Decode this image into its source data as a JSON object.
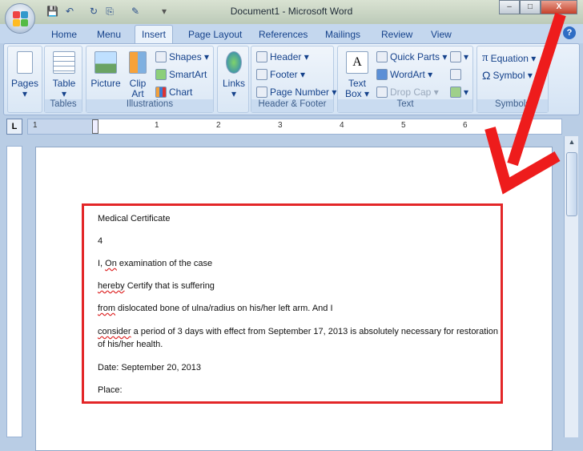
{
  "window": {
    "title": "Document1 - Microsoft Word",
    "minimize": "–",
    "maximize": "□",
    "close": "X"
  },
  "tabs": [
    "Home",
    "Menu",
    "Insert",
    "Page Layout",
    "References",
    "Mailings",
    "Review",
    "View"
  ],
  "active_tab": "Insert",
  "ribbon": {
    "pages": {
      "label": "Pages",
      "group": ""
    },
    "tables": {
      "table": "Table",
      "group": "Tables"
    },
    "illustrations": {
      "picture": "Picture",
      "clip_art": "Clip Art",
      "shapes": "Shapes ▾",
      "smartart": "SmartArt",
      "chart": "Chart",
      "group": "Illustrations"
    },
    "links": {
      "label": "Links"
    },
    "header_footer": {
      "header": "Header ▾",
      "footer": "Footer ▾",
      "page_number": "Page Number ▾",
      "group": "Header & Footer"
    },
    "text": {
      "text_box": "Text Box ▾",
      "quick_parts": "Quick Parts ▾",
      "wordart": "WordArt ▾",
      "drop_cap": "Drop Cap ▾",
      "group": "Text"
    },
    "symbols": {
      "equation": "Equation ▾",
      "symbol": "Symbol ▾",
      "group": "Symbols"
    }
  },
  "ruler": {
    "tab_selector": "L",
    "numbers": [
      "1",
      "1",
      "2",
      "3",
      "4",
      "5",
      "6"
    ]
  },
  "document": {
    "title": "Medical Certificate",
    "number": "4",
    "line1_a": "I, ",
    "line1_err": "On",
    "line1_b": " examination of the case",
    "line2_err": "hereby",
    "line2_b": " Certify that is suffering",
    "line3_err": "from",
    "line3_b": " dislocated bone of ulna/radius on his/her left arm. And I",
    "line4_err": "consider",
    "line4_b": " a period  of 3 days with effect from September 17, 2013 is absolutely necessary for restoration",
    "line5": "of his/her health.",
    "date": "Date: September 20, 2013",
    "place": "Place:"
  },
  "annotation": {
    "arrow_color": "#ee1c1c",
    "box_color": "#e32628"
  }
}
